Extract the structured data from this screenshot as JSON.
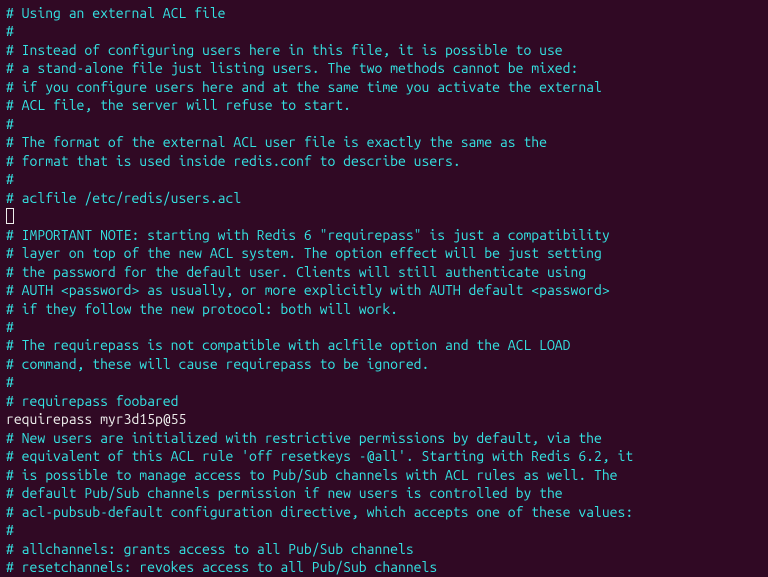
{
  "lines": [
    {
      "cls": "comment",
      "text": "# Using an external ACL file"
    },
    {
      "cls": "comment",
      "text": "#"
    },
    {
      "cls": "comment",
      "text": "# Instead of configuring users here in this file, it is possible to use"
    },
    {
      "cls": "comment",
      "text": "# a stand-alone file just listing users. The two methods cannot be mixed:"
    },
    {
      "cls": "comment",
      "text": "# if you configure users here and at the same time you activate the external"
    },
    {
      "cls": "comment",
      "text": "# ACL file, the server will refuse to start."
    },
    {
      "cls": "comment",
      "text": "#"
    },
    {
      "cls": "comment",
      "text": "# The format of the external ACL user file is exactly the same as the"
    },
    {
      "cls": "comment",
      "text": "# format that is used inside redis.conf to describe users."
    },
    {
      "cls": "comment",
      "text": "#"
    },
    {
      "cls": "comment",
      "text": "# aclfile /etc/redis/users.acl"
    },
    {
      "cls": "cursor",
      "text": ""
    },
    {
      "cls": "comment",
      "text": "# IMPORTANT NOTE: starting with Redis 6 \"requirepass\" is just a compatibility"
    },
    {
      "cls": "comment",
      "text": "# layer on top of the new ACL system. The option effect will be just setting"
    },
    {
      "cls": "comment",
      "text": "# the password for the default user. Clients will still authenticate using"
    },
    {
      "cls": "comment",
      "text": "# AUTH <password> as usually, or more explicitly with AUTH default <password>"
    },
    {
      "cls": "comment",
      "text": "# if they follow the new protocol: both will work."
    },
    {
      "cls": "comment",
      "text": "#"
    },
    {
      "cls": "comment",
      "text": "# The requirepass is not compatible with aclfile option and the ACL LOAD"
    },
    {
      "cls": "comment",
      "text": "# command, these will cause requirepass to be ignored."
    },
    {
      "cls": "comment",
      "text": "#"
    },
    {
      "cls": "comment",
      "text": "# requirepass foobared"
    },
    {
      "cls": "plain",
      "text": "requirepass myr3d15p@55"
    },
    {
      "cls": "plain",
      "text": ""
    },
    {
      "cls": "plain",
      "text": ""
    },
    {
      "cls": "comment",
      "text": "# New users are initialized with restrictive permissions by default, via the"
    },
    {
      "cls": "comment",
      "text": "# equivalent of this ACL rule 'off resetkeys -@all'. Starting with Redis 6.2, it"
    },
    {
      "cls": "comment",
      "text": "# is possible to manage access to Pub/Sub channels with ACL rules as well. The"
    },
    {
      "cls": "comment",
      "text": "# default Pub/Sub channels permission if new users is controlled by the"
    },
    {
      "cls": "comment",
      "text": "# acl-pubsub-default configuration directive, which accepts one of these values:"
    },
    {
      "cls": "comment",
      "text": "#"
    },
    {
      "cls": "comment",
      "text": "# allchannels: grants access to all Pub/Sub channels"
    },
    {
      "cls": "comment",
      "text": "# resetchannels: revokes access to all Pub/Sub channels"
    }
  ],
  "edited_line_index": 22,
  "cursor_line_index": 11
}
